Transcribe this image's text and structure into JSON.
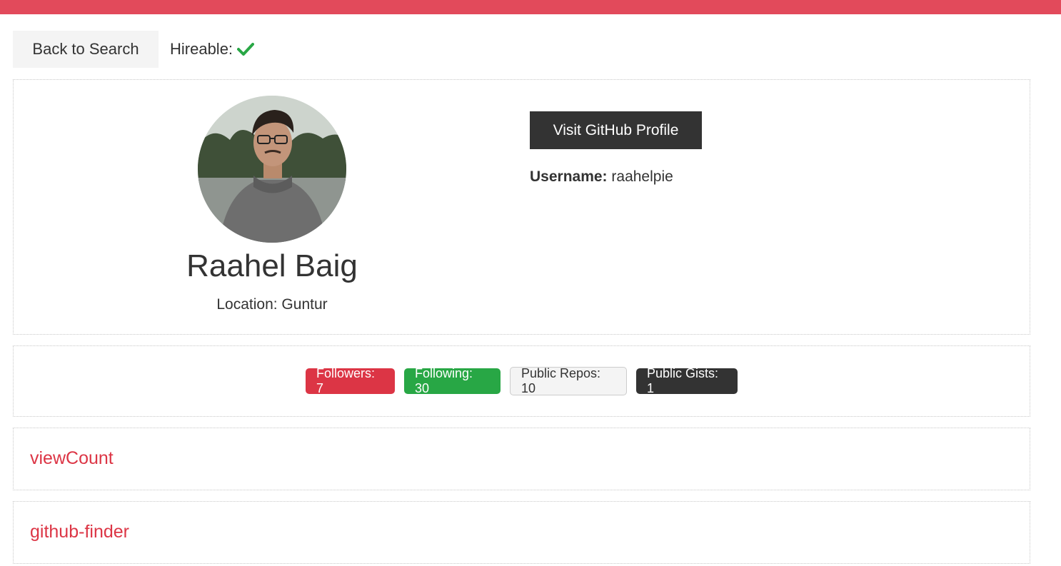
{
  "header": {
    "accent_color": "#e24a5b"
  },
  "toolbar": {
    "back_label": "Back to Search",
    "hireable_label": "Hireable:",
    "hireable_icon": "check-icon",
    "hireable_color": "#28a745"
  },
  "profile": {
    "avatar": "user-photo",
    "name": "Raahel Baig",
    "location": "Location: Guntur",
    "visit_label": "Visit GitHub Profile",
    "username_label": "Username:",
    "username_value": "raahelpie"
  },
  "stats": {
    "followers": "Followers: 7",
    "following": "Following: 30",
    "public_repos": "Public Repos: 10",
    "public_gists": "Public Gists: 1"
  },
  "repos": [
    {
      "name": "viewCount"
    },
    {
      "name": "github-finder"
    }
  ]
}
